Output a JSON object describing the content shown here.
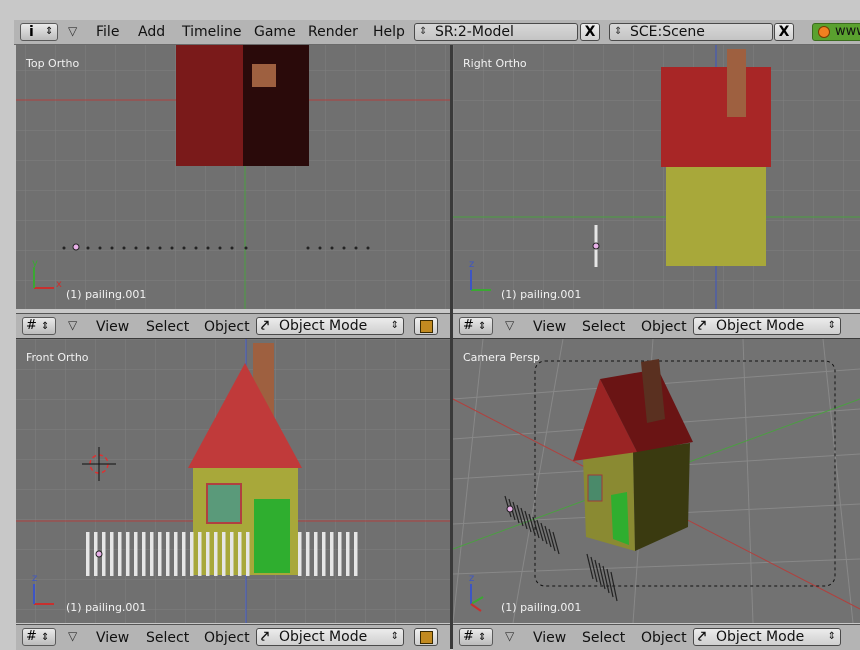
{
  "menubar": {
    "info_icon": "i",
    "items": [
      "File",
      "Add",
      "Timeline",
      "Game",
      "Render",
      "Help"
    ],
    "screen": "SR:2-Model",
    "scene": "SCE:Scene",
    "close": "X",
    "www": "www"
  },
  "viewports": {
    "top": {
      "label": "Top Ortho",
      "object": "(1) pailing.001"
    },
    "right": {
      "label": "Right Ortho",
      "object": "(1) pailing.001"
    },
    "front": {
      "label": "Front Ortho",
      "object": "(1) pailing.001"
    },
    "camera": {
      "label": "Camera Persp",
      "object": "(1) pailing.001"
    }
  },
  "header": {
    "view": "View",
    "select": "Select",
    "object": "Object",
    "mode": "Object Mode",
    "grid_icon": "grid-icon",
    "mode_icon": "object-mode-icon",
    "shade_icon": "solid-shading-icon"
  },
  "axis": {
    "x": "x",
    "y": "y",
    "z": "z"
  },
  "colors": {
    "viewport_bg": "#707070",
    "roof": "#9a2e2e",
    "wall": "#8a8a32",
    "door": "#2f9a2f",
    "chimney": "#8e5a3c",
    "fence": "#e6e6e6",
    "x_axis": "#c8302e",
    "y_axis": "#3aa832",
    "z_axis": "#3d55c4"
  }
}
